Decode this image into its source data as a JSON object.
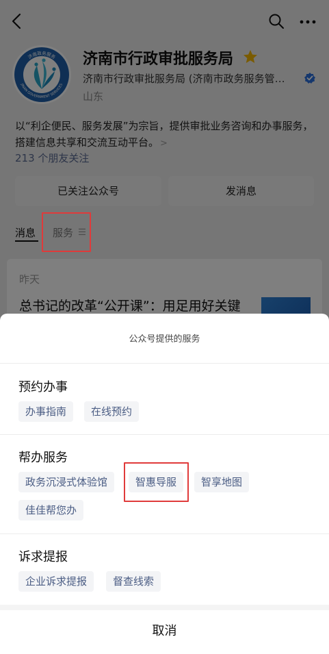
{
  "profile": {
    "name": "济南市行政审批服务局",
    "subtitle": "济南市行政审批服务局 (济南市政务服务管…",
    "region": "山东",
    "description": "以“利企便民、服务发展”为宗旨，提供审批业务咨询和办事服务，搭建信息共享和交流互动平台。",
    "followers": "213 个朋友关注",
    "logo_arc_text": "济南政务服务",
    "logo_bottom_text": "JINAN GOVERNMENT SERVICES"
  },
  "actions": {
    "follow_label": "已关注公众号",
    "message_label": "发消息"
  },
  "tabs": {
    "messages": "消息",
    "service": "服务"
  },
  "feed": {
    "date": "昨天",
    "article_title": "总书记的改革“公开课”：用足用好关键"
  },
  "sheet": {
    "title": "公众号提供的服务",
    "sections": [
      {
        "title": "预约办事",
        "items": [
          "办事指南",
          "在线预约"
        ]
      },
      {
        "title": "帮办服务",
        "items": [
          "政务沉浸式体验馆",
          "智惠导服",
          "智享地图",
          "佳佳帮您办"
        ]
      },
      {
        "title": "诉求提报",
        "items": [
          "企业诉求提报",
          "督查线索"
        ]
      }
    ],
    "cancel": "取消"
  },
  "colors": {
    "highlight": "#e03a3a",
    "link": "#5b6b92",
    "chip_text": "#4b5d84",
    "verified": "#2a6fdb",
    "star": "#f5b700"
  }
}
